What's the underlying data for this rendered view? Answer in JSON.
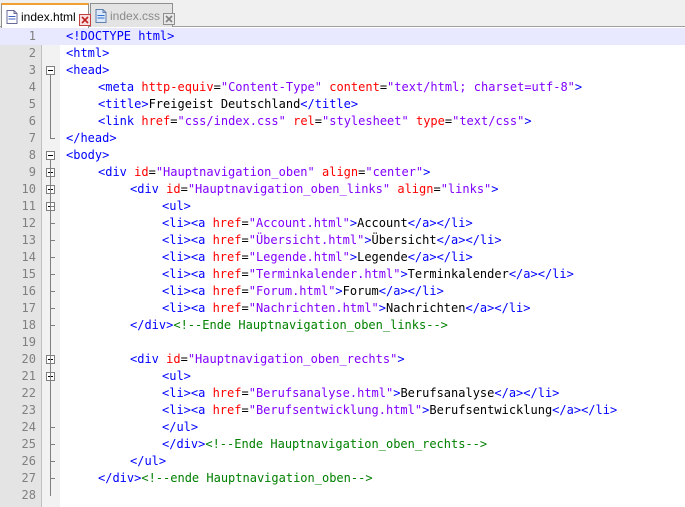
{
  "tabs": [
    {
      "label": "index.html",
      "active": true
    },
    {
      "label": "index.css",
      "active": false
    }
  ],
  "colors": {
    "tag": "#0000ff",
    "attribute": "#ff0000",
    "value": "#8000ff",
    "comment": "#008000",
    "text": "#000000",
    "active_tab_accent": "#f0a030"
  },
  "icons": {
    "file": "html-file-icon",
    "close": "close-tab-icon"
  },
  "lines": [
    {
      "n": "1",
      "indent": 0,
      "tokens": [
        {
          "k": "t",
          "s": "<!DOCTYPE html>"
        }
      ]
    },
    {
      "n": "2",
      "indent": 0,
      "tokens": [
        {
          "k": "t",
          "s": "<html>"
        }
      ]
    },
    {
      "n": "3",
      "indent": 0,
      "tokens": [
        {
          "k": "t",
          "s": "<head>"
        }
      ]
    },
    {
      "n": "4",
      "indent": 1,
      "tokens": [
        {
          "k": "t",
          "s": "<meta "
        },
        {
          "k": "a",
          "s": "http-equiv"
        },
        {
          "k": "x",
          "s": "="
        },
        {
          "k": "v",
          "s": "\"Content-Type\""
        },
        {
          "k": "x",
          "s": " "
        },
        {
          "k": "a",
          "s": "content"
        },
        {
          "k": "x",
          "s": "="
        },
        {
          "k": "v",
          "s": "\"text/html; charset=utf-8\""
        },
        {
          "k": "t",
          "s": ">"
        }
      ]
    },
    {
      "n": "5",
      "indent": 1,
      "tokens": [
        {
          "k": "t",
          "s": "<title>"
        },
        {
          "k": "x",
          "s": "Freigeist Deutschland"
        },
        {
          "k": "t",
          "s": "</title>"
        }
      ]
    },
    {
      "n": "6",
      "indent": 1,
      "tokens": [
        {
          "k": "t",
          "s": "<link "
        },
        {
          "k": "a",
          "s": "href"
        },
        {
          "k": "x",
          "s": "="
        },
        {
          "k": "v",
          "s": "\"css/index.css\""
        },
        {
          "k": "x",
          "s": " "
        },
        {
          "k": "a",
          "s": "rel"
        },
        {
          "k": "x",
          "s": "="
        },
        {
          "k": "v",
          "s": "\"stylesheet\""
        },
        {
          "k": "x",
          "s": " "
        },
        {
          "k": "a",
          "s": "type"
        },
        {
          "k": "x",
          "s": "="
        },
        {
          "k": "v",
          "s": "\"text/css\""
        },
        {
          "k": "t",
          "s": ">"
        }
      ]
    },
    {
      "n": "7",
      "indent": 0,
      "tokens": [
        {
          "k": "t",
          "s": "</head>"
        }
      ]
    },
    {
      "n": "8",
      "indent": 0,
      "tokens": [
        {
          "k": "t",
          "s": "<body>"
        }
      ]
    },
    {
      "n": "9",
      "indent": 1,
      "tokens": [
        {
          "k": "t",
          "s": "<div "
        },
        {
          "k": "a",
          "s": "id"
        },
        {
          "k": "x",
          "s": "="
        },
        {
          "k": "v",
          "s": "\"Hauptnavigation_oben\""
        },
        {
          "k": "x",
          "s": " "
        },
        {
          "k": "a",
          "s": "align"
        },
        {
          "k": "x",
          "s": "="
        },
        {
          "k": "v",
          "s": "\"center\""
        },
        {
          "k": "t",
          "s": ">"
        }
      ]
    },
    {
      "n": "10",
      "indent": 2,
      "tokens": [
        {
          "k": "t",
          "s": "<div "
        },
        {
          "k": "a",
          "s": "id"
        },
        {
          "k": "x",
          "s": "="
        },
        {
          "k": "v",
          "s": "\"Hauptnavigation_oben_links\""
        },
        {
          "k": "x",
          "s": " "
        },
        {
          "k": "a",
          "s": "align"
        },
        {
          "k": "x",
          "s": "="
        },
        {
          "k": "v",
          "s": "\"links\""
        },
        {
          "k": "t",
          "s": ">"
        }
      ]
    },
    {
      "n": "11",
      "indent": 3,
      "tokens": [
        {
          "k": "t",
          "s": "<ul>"
        }
      ]
    },
    {
      "n": "12",
      "indent": 3,
      "tokens": [
        {
          "k": "t",
          "s": "<li><a "
        },
        {
          "k": "a",
          "s": "href"
        },
        {
          "k": "x",
          "s": "="
        },
        {
          "k": "v",
          "s": "\"Account.html\""
        },
        {
          "k": "t",
          "s": ">"
        },
        {
          "k": "x",
          "s": "Account"
        },
        {
          "k": "t",
          "s": "</a></li>"
        }
      ]
    },
    {
      "n": "13",
      "indent": 3,
      "tokens": [
        {
          "k": "t",
          "s": "<li><a "
        },
        {
          "k": "a",
          "s": "href"
        },
        {
          "k": "x",
          "s": "="
        },
        {
          "k": "v",
          "s": "\"Übersicht.html\""
        },
        {
          "k": "t",
          "s": ">"
        },
        {
          "k": "x",
          "s": "Übersicht"
        },
        {
          "k": "t",
          "s": "</a></li>"
        }
      ]
    },
    {
      "n": "14",
      "indent": 3,
      "tokens": [
        {
          "k": "t",
          "s": "<li><a "
        },
        {
          "k": "a",
          "s": "href"
        },
        {
          "k": "x",
          "s": "="
        },
        {
          "k": "v",
          "s": "\"Legende.html\""
        },
        {
          "k": "t",
          "s": ">"
        },
        {
          "k": "x",
          "s": "Legende"
        },
        {
          "k": "t",
          "s": "</a></li>"
        }
      ]
    },
    {
      "n": "15",
      "indent": 3,
      "tokens": [
        {
          "k": "t",
          "s": "<li><a "
        },
        {
          "k": "a",
          "s": "href"
        },
        {
          "k": "x",
          "s": "="
        },
        {
          "k": "v",
          "s": "\"Terminkalender.html\""
        },
        {
          "k": "t",
          "s": ">"
        },
        {
          "k": "x",
          "s": "Terminkalender"
        },
        {
          "k": "t",
          "s": "</a></li>"
        }
      ]
    },
    {
      "n": "16",
      "indent": 3,
      "tokens": [
        {
          "k": "t",
          "s": "<li><a "
        },
        {
          "k": "a",
          "s": "href"
        },
        {
          "k": "x",
          "s": "="
        },
        {
          "k": "v",
          "s": "\"Forum.html\""
        },
        {
          "k": "t",
          "s": ">"
        },
        {
          "k": "x",
          "s": "Forum"
        },
        {
          "k": "t",
          "s": "</a></li>"
        }
      ]
    },
    {
      "n": "17",
      "indent": 3,
      "tokens": [
        {
          "k": "t",
          "s": "<li><a "
        },
        {
          "k": "a",
          "s": "href"
        },
        {
          "k": "x",
          "s": "="
        },
        {
          "k": "v",
          "s": "\"Nachrichten.html\""
        },
        {
          "k": "t",
          "s": ">"
        },
        {
          "k": "x",
          "s": "Nachrichten"
        },
        {
          "k": "t",
          "s": "</a></li>"
        }
      ]
    },
    {
      "n": "18",
      "indent": 2,
      "tokens": [
        {
          "k": "t",
          "s": "</div>"
        },
        {
          "k": "c",
          "s": "<!--Ende Hauptnavigation_oben_links-->"
        }
      ]
    },
    {
      "n": "19",
      "indent": 0,
      "tokens": []
    },
    {
      "n": "20",
      "indent": 2,
      "tokens": [
        {
          "k": "t",
          "s": "<div "
        },
        {
          "k": "a",
          "s": "id"
        },
        {
          "k": "x",
          "s": "="
        },
        {
          "k": "v",
          "s": "\"Hauptnavigation_oben_rechts\""
        },
        {
          "k": "t",
          "s": ">"
        }
      ]
    },
    {
      "n": "21",
      "indent": 3,
      "tokens": [
        {
          "k": "t",
          "s": "<ul>"
        }
      ]
    },
    {
      "n": "22",
      "indent": 3,
      "tokens": [
        {
          "k": "t",
          "s": "<li><a "
        },
        {
          "k": "a",
          "s": "href"
        },
        {
          "k": "x",
          "s": "="
        },
        {
          "k": "v",
          "s": "\"Berufsanalyse.html\""
        },
        {
          "k": "t",
          "s": ">"
        },
        {
          "k": "x",
          "s": "Berufsanalyse"
        },
        {
          "k": "t",
          "s": "</a></li>"
        }
      ]
    },
    {
      "n": "23",
      "indent": 3,
      "tokens": [
        {
          "k": "t",
          "s": "<li><a "
        },
        {
          "k": "a",
          "s": "href"
        },
        {
          "k": "x",
          "s": "="
        },
        {
          "k": "v",
          "s": "\"Berufsentwicklung.html\""
        },
        {
          "k": "t",
          "s": ">"
        },
        {
          "k": "x",
          "s": "Berufsentwicklung"
        },
        {
          "k": "t",
          "s": "</a></li>"
        }
      ]
    },
    {
      "n": "24",
      "indent": 3,
      "tokens": [
        {
          "k": "t",
          "s": "</ul>"
        }
      ]
    },
    {
      "n": "25",
      "indent": 3,
      "tokens": [
        {
          "k": "t",
          "s": "</div>"
        },
        {
          "k": "c",
          "s": "<!--Ende Hauptnavigation_oben_rechts-->"
        }
      ]
    },
    {
      "n": "26",
      "indent": 2,
      "tokens": [
        {
          "k": "t",
          "s": "</ul>"
        }
      ]
    },
    {
      "n": "27",
      "indent": 1,
      "tokens": [
        {
          "k": "t",
          "s": "</div>"
        },
        {
          "k": "c",
          "s": "<!--ende Hauptnavigation_oben-->"
        }
      ]
    },
    {
      "n": "28",
      "indent": 0,
      "tokens": []
    }
  ]
}
